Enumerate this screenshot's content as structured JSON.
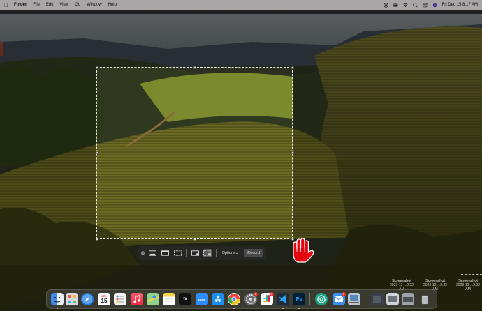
{
  "menubar": {
    "app_name": "Finder",
    "menus": [
      "File",
      "Edit",
      "View",
      "Go",
      "Window",
      "Help"
    ],
    "clock": "Fri Dec 15  8:17 AM"
  },
  "toolbar": {
    "options_label": "Options",
    "options_chevron": "⌄",
    "record_label": "Record",
    "close_icon": "close-icon",
    "buttons": [
      "capture-entire-screen-icon",
      "capture-window-icon",
      "capture-selection-icon",
      "record-entire-screen-icon",
      "record-selection-icon"
    ]
  },
  "desktop_files": [
    {
      "name": "Screenshot",
      "date": "2023-12-...2.22 AM"
    },
    {
      "name": "Screenshot",
      "date": "2023-12-...2.23 AM"
    },
    {
      "name": "Screenshot",
      "date": "2023-12-...2.23 AM"
    }
  ],
  "dock": {
    "apps": [
      "Finder",
      "Launchpad",
      "Safari",
      "Calendar",
      "Reminders",
      "Music",
      "Maps",
      "Notes",
      "Apple TV",
      "Zoom",
      "App Store",
      "Chrome",
      "System Settings",
      "Slack",
      "VS Code",
      "Photoshop",
      "ChatGPT",
      "Mail",
      "Preview"
    ],
    "calendar_day": "15",
    "calendar_month": "DEC",
    "tv_label": "tv",
    "ps_label": "Ps",
    "zoom_label": "zoom",
    "badge_system": "1",
    "badge_slack": "1",
    "badge_mail": "1"
  },
  "colors": {
    "menubar_bg": "#e9e7e8",
    "cursor_red": "#e3060f",
    "toolbar_bg": "#2b2b2b"
  }
}
